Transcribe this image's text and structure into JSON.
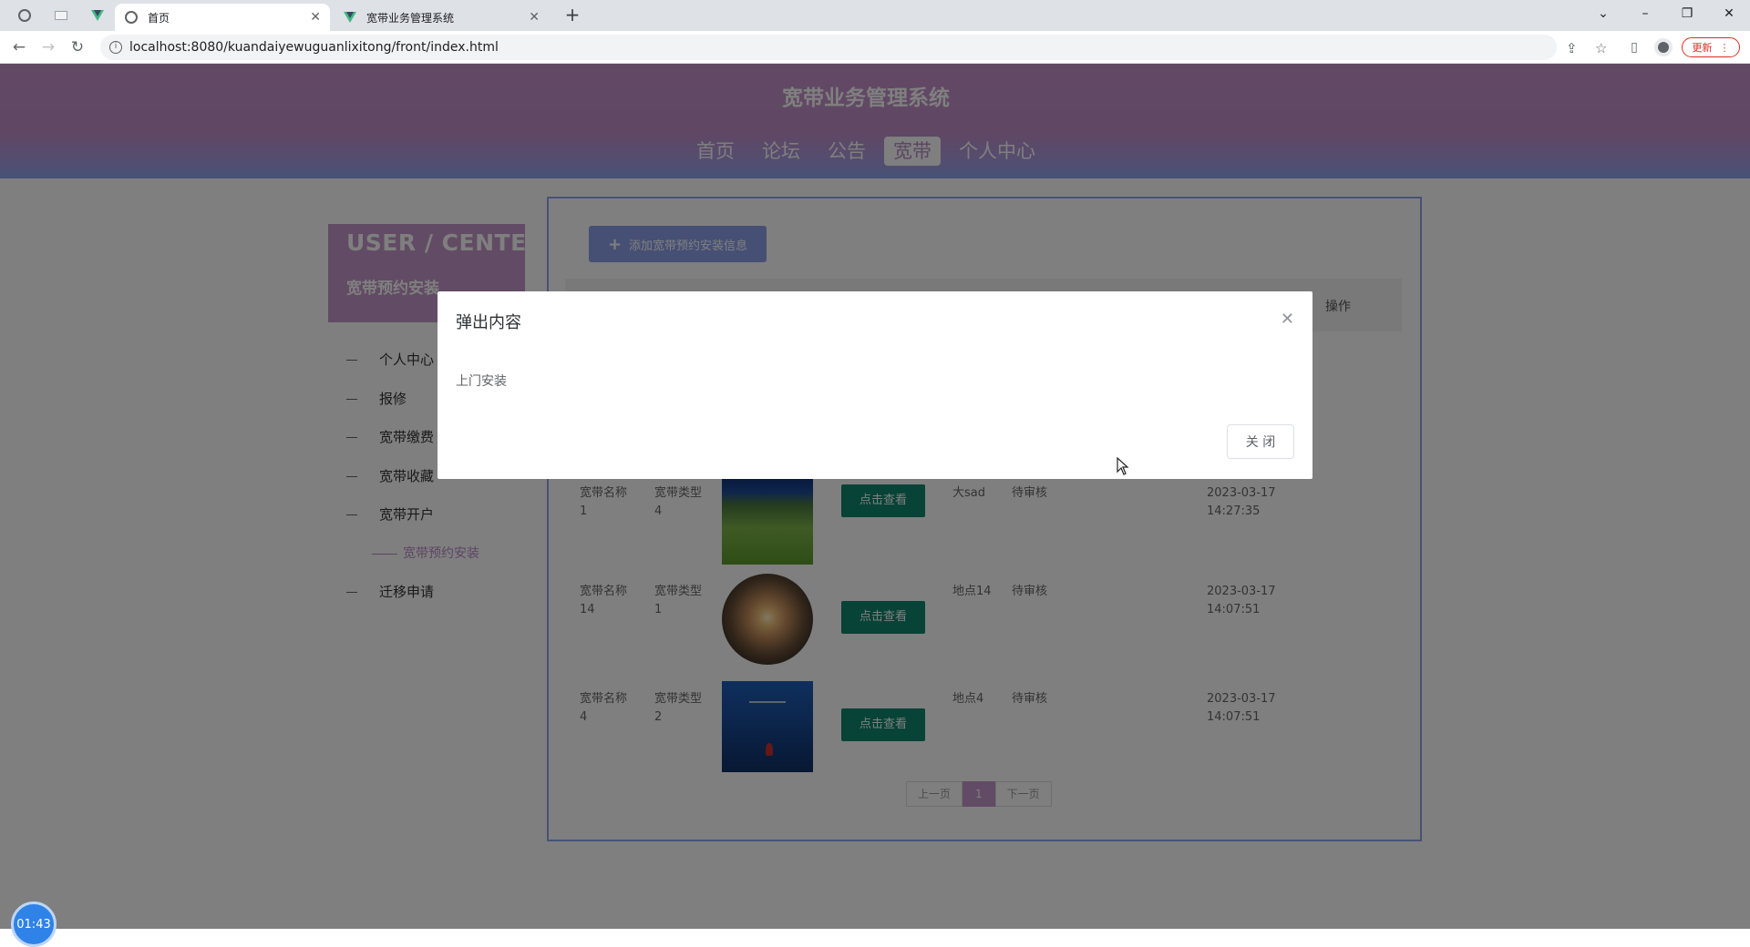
{
  "browser": {
    "tabs": [
      {
        "title": "首页",
        "active": true
      },
      {
        "title": "宽带业务管理系统",
        "active": false
      }
    ],
    "url": "localhost:8080/kuandaiyewuguanlixitong/front/index.html",
    "update_label": "更新"
  },
  "site": {
    "title": "宽带业务管理系统",
    "nav": [
      "首页",
      "论坛",
      "公告",
      "宽带",
      "个人中心"
    ],
    "active_nav": "宽带"
  },
  "sidebar": {
    "card_en": "USER / CENTER",
    "card_cn": "宽带预约安装",
    "items": [
      "个人中心",
      "报修",
      "宽带缴费",
      "宽带收藏",
      "宽带开户",
      "宽带预约安装",
      "迁移申请"
    ]
  },
  "main": {
    "add_button": "添加宽带预约安装信息",
    "header_op": "操作",
    "rows": [
      {
        "name": "宽带名称1",
        "type": "宽带类型4",
        "button": "点击查看",
        "location": "大sad",
        "status": "待审核",
        "time": "2023-03-17 14:27:35",
        "image": "field"
      },
      {
        "name": "宽带名称14",
        "type": "宽带类型1",
        "button": "点击查看",
        "location": "地点14",
        "status": "待审核",
        "time": "2023-03-17 14:07:51",
        "image": "sunset"
      },
      {
        "name": "宽带名称4",
        "type": "宽带类型2",
        "button": "点击查看",
        "location": "地点4",
        "status": "待审核",
        "time": "2023-03-17 14:07:51",
        "image": "sea"
      }
    ],
    "pager": {
      "prev": "上一页",
      "current": "1",
      "next": "下一页"
    }
  },
  "modal": {
    "title": "弹出内容",
    "body": "上门安装",
    "close_button": "关 闭"
  },
  "timer": "01:43",
  "colors": {
    "header_top": "#c592c8",
    "header_bottom": "#8da7ee",
    "accent": "#c596c8",
    "view_button": "#11876f"
  }
}
